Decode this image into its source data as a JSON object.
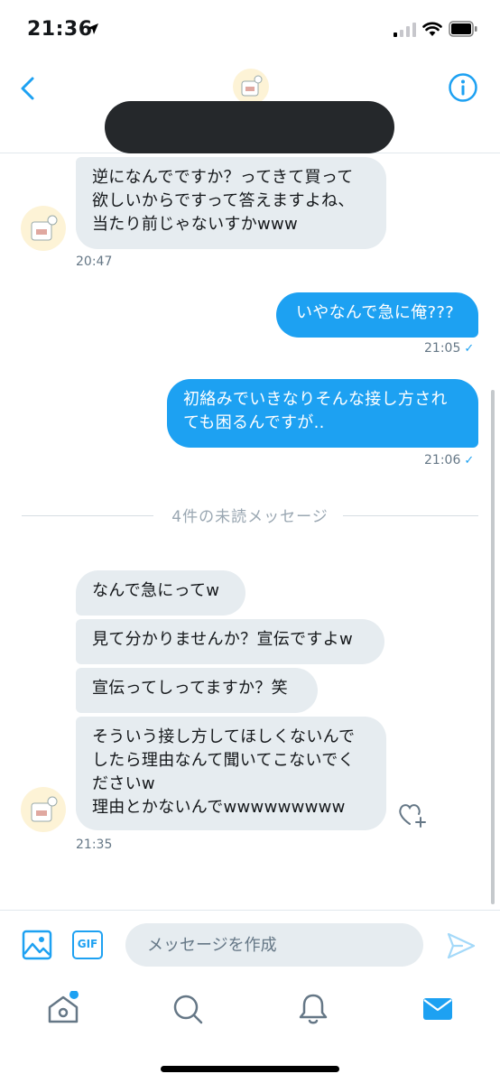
{
  "status_bar": {
    "time": "21:36"
  },
  "colors": {
    "accent": "#1da1f2",
    "received_bubble": "#e6ecf0",
    "redaction": "#25282b"
  },
  "messages": {
    "m1": {
      "text": "逆になんでですか？ってきて買って\n欲しいからですって答えますよね、\n当たり前じゃないすかwww",
      "time": "20:47"
    },
    "m2": {
      "text": "いやなんで急に俺???",
      "time": "21:05"
    },
    "m3": {
      "text": "初絡みでいきなりそんな接し方され\nても困るんですが..",
      "time": "21:06"
    },
    "unread_divider": "4件の未読メッセージ",
    "m4": {
      "text": "なんで急にってw"
    },
    "m5": {
      "text": "見て分かりませんか？宣伝ですよw"
    },
    "m6": {
      "text": "宣伝ってしってますか？笑"
    },
    "m7": {
      "text": "そういう接し方してほしくないんで\nしたら理由なんて聞いてこないでく\nださいw\n理由とかないんでwwwwwwwww",
      "time": "21:35"
    }
  },
  "composer": {
    "gif_label": "GIF",
    "placeholder": "メッセージを作成"
  },
  "icons": [
    "back-icon",
    "info-icon",
    "image-icon",
    "gif-icon",
    "send-icon",
    "heart-plus-icon",
    "home-icon",
    "search-icon",
    "bell-icon",
    "mail-icon"
  ]
}
